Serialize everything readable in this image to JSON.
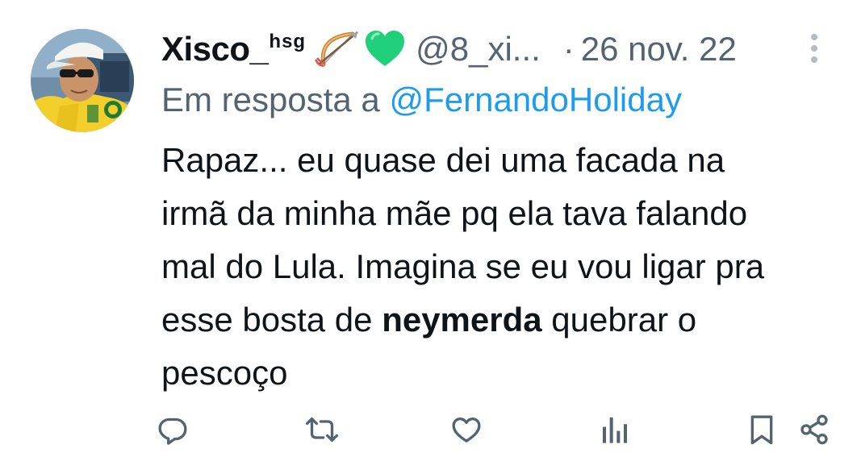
{
  "tweet": {
    "display_name": "Xisco_",
    "display_name_sup": "hsg",
    "emojis": [
      "bow-and-arrow-emoji",
      "green-heart-emoji"
    ],
    "handle": "@8_xi...",
    "separator": "·",
    "date": "26 nov. 22",
    "reply_prefix": "Em resposta a",
    "reply_to": "@FernandoHoliday",
    "text_lines": [
      "Rapaz... eu quase dei uma facada na",
      "irmã da minha mãe pq ela tava falando",
      "mal do Lula. Imagina se eu vou ligar pra"
    ],
    "line4_before": "esse bosta de ",
    "line4_bold": "neymerda",
    "line4_after": " quebrar o",
    "line5": "pescoço"
  },
  "actions": [
    "reply-icon",
    "retweet-icon",
    "like-icon",
    "views-icon",
    "bookmark-icon",
    "share-icon"
  ],
  "colors": {
    "text_primary": "#0f1419",
    "text_secondary": "#536471",
    "link": "#1d9bf0",
    "heart_green": "#1fcf7a",
    "bow_orange": "#e8a14e"
  }
}
